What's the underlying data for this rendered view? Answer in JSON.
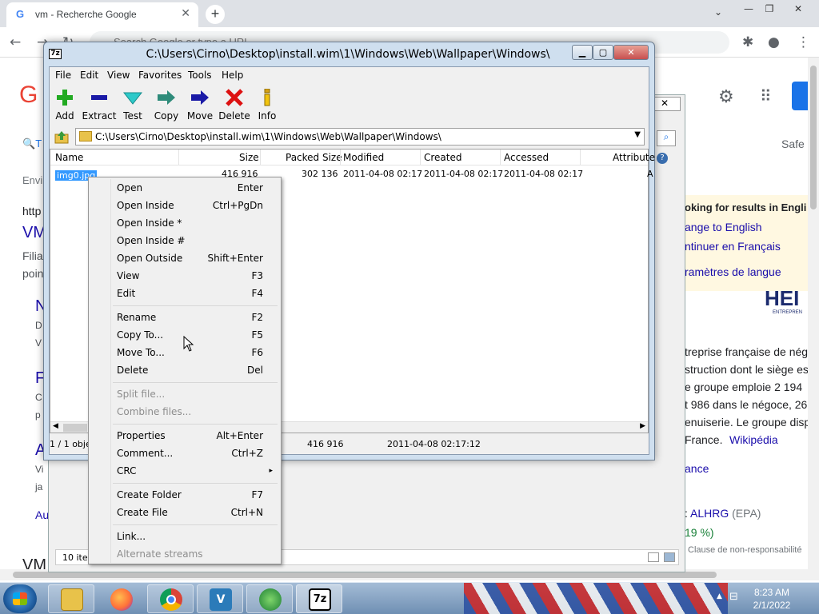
{
  "chrome": {
    "tab_title": "vm - Recherche Google",
    "tab_favicon": "google-icon",
    "omnibox_placeholder": "Search Google or type a URL",
    "page_fragments": {
      "nav_letter": "T",
      "safe": "Safe",
      "env": "Envi",
      "https": "http",
      "vm_link": "VM",
      "filia": "Filia",
      "poin": "poin",
      "n_link": "N",
      "d": "D",
      "v": "V",
      "f_link": "F",
      "c": "C",
      "p": "p",
      "a_link": "A",
      "vi": "Vi",
      "ja": "ja",
      "au": "Au",
      "vm_bottom": "VM"
    },
    "panel": {
      "looking": "oking for results in Engli",
      "change": "ange to English",
      "continue": "ntinuer en Français",
      "params": "ramètres de langue"
    },
    "knowledge": {
      "logo": "HEI",
      "logo_sub": "ENTREPREN",
      "lines": [
        "treprise française de négo",
        "struction dont le siège est",
        "e groupe emploie 2 194",
        "t 986 dans le négoce, 26",
        "enuiserie. Le groupe disp",
        "France."
      ],
      "wiki": "Wikipédia",
      "ance": "ance",
      "ticker_label": ": ",
      "ticker": "ALHRG",
      "ticker_epa": " (EPA)",
      "change": "19 %)",
      "disclaimer": "Clause de non-responsabilité"
    }
  },
  "behind_window": {
    "status": "10 iter"
  },
  "sevenzip": {
    "title": "C:\\Users\\Cirno\\Desktop\\install.wim\\1\\Windows\\Web\\Wallpaper\\Windows\\",
    "menu": [
      "File",
      "Edit",
      "View",
      "Favorites",
      "Tools",
      "Help"
    ],
    "toolbar": {
      "add": "Add",
      "extract": "Extract",
      "test": "Test",
      "copy": "Copy",
      "move": "Move",
      "delete": "Delete",
      "info": "Info"
    },
    "address": "C:\\Users\\Cirno\\Desktop\\install.wim\\1\\Windows\\Web\\Wallpaper\\Windows\\",
    "columns": {
      "name": "Name",
      "size": "Size",
      "packed": "Packed Size",
      "modified": "Modified",
      "created": "Created",
      "accessed": "Accessed",
      "attributes": "Attribute"
    },
    "rows": [
      {
        "name": "img0.jpg",
        "size": "416 916",
        "packed": "302 136",
        "modified": "2011-04-08 02:17",
        "created": "2011-04-08 02:17",
        "accessed": "2011-04-08 02:17",
        "attributes": "A"
      }
    ],
    "status": {
      "selection": "1 / 1 obje",
      "size": "416 916",
      "modified": "2011-04-08 02:17:12"
    }
  },
  "context_menu": {
    "open": {
      "label": "Open",
      "shortcut": "Enter"
    },
    "open_inside": {
      "label": "Open Inside",
      "shortcut": "Ctrl+PgDn"
    },
    "open_inside_star": {
      "label": "Open Inside *",
      "shortcut": ""
    },
    "open_inside_hash": {
      "label": "Open Inside #",
      "shortcut": ""
    },
    "open_outside": {
      "label": "Open Outside",
      "shortcut": "Shift+Enter"
    },
    "view": {
      "label": "View",
      "shortcut": "F3"
    },
    "edit": {
      "label": "Edit",
      "shortcut": "F4"
    },
    "rename": {
      "label": "Rename",
      "shortcut": "F2"
    },
    "copy_to": {
      "label": "Copy To...",
      "shortcut": "F5"
    },
    "move_to": {
      "label": "Move To...",
      "shortcut": "F6"
    },
    "delete": {
      "label": "Delete",
      "shortcut": "Del"
    },
    "split": {
      "label": "Split file...",
      "shortcut": ""
    },
    "combine": {
      "label": "Combine files...",
      "shortcut": ""
    },
    "properties": {
      "label": "Properties",
      "shortcut": "Alt+Enter"
    },
    "comment": {
      "label": "Comment...",
      "shortcut": "Ctrl+Z"
    },
    "crc": {
      "label": "CRC",
      "shortcut": "▸"
    },
    "create_folder": {
      "label": "Create Folder",
      "shortcut": "F7"
    },
    "create_file": {
      "label": "Create File",
      "shortcut": "Ctrl+N"
    },
    "link": {
      "label": "Link...",
      "shortcut": ""
    },
    "alt_streams": {
      "label": "Alternate streams",
      "shortcut": ""
    }
  },
  "taskbar": {
    "apps": [
      "file-explorer-icon",
      "firefox-icon",
      "chrome-icon",
      "vmware-icon",
      "network-icon",
      "7zip-icon"
    ],
    "sevenzip_glyph": "7z",
    "vmware_glyph": "V",
    "time": "8:23 AM",
    "date": "2/1/2022"
  },
  "colors": {
    "selection": "#3399ff",
    "disabled_text": "#8d8d8d",
    "google_link": "#1a0dab"
  }
}
